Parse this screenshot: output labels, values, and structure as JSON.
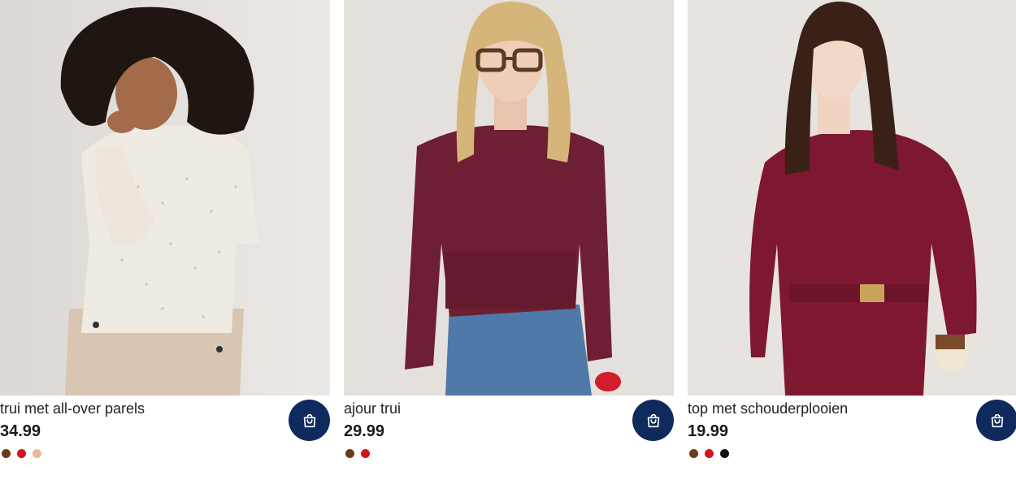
{
  "products": [
    {
      "name": "trui met all-over parels",
      "price": "34.99",
      "swatches": [
        "#6b3a14",
        "#d4141c",
        "#e9b99a"
      ],
      "image_icon": "product-photo",
      "cart_icon": "shopping-bag-icon"
    },
    {
      "name": "ajour trui",
      "price": "29.99",
      "swatches": [
        "#6b3a14",
        "#d4141c"
      ],
      "image_icon": "product-photo",
      "cart_icon": "shopping-bag-icon"
    },
    {
      "name": "top met schouderplooien",
      "price": "19.99",
      "swatches": [
        "#6b3a14",
        "#d4141c",
        "#111111"
      ],
      "image_icon": "product-photo",
      "cart_icon": "shopping-bag-icon"
    }
  ],
  "colors": {
    "cart_button_bg": "#0f2a5c",
    "page_bg": "#ffffff"
  }
}
